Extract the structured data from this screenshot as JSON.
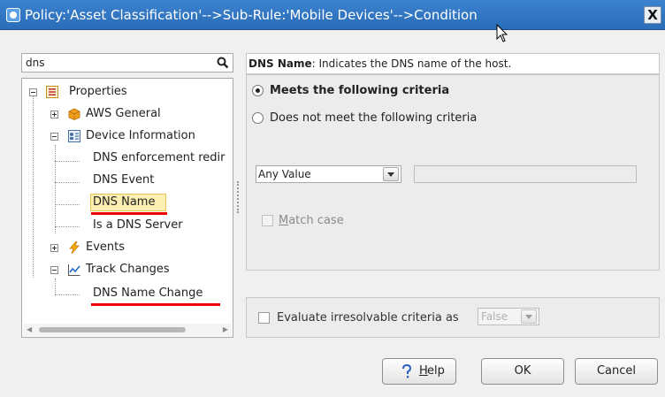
{
  "window": {
    "title": "Policy:'Asset Classification'-->Sub-Rule:'Mobile Devices'-->Condition",
    "close_label": "X"
  },
  "search": {
    "value": "dns"
  },
  "tree": {
    "root": "Properties",
    "aws_general": "AWS General",
    "device_information": "Device Information",
    "dns_enforcement": "DNS enforcement redir",
    "dns_event": "DNS Event",
    "dns_name": "DNS Name",
    "is_dns_server": "Is a DNS Server",
    "events": "Events",
    "track_changes": "Track Changes",
    "dns_name_change": "DNS Name Change",
    "selected": "DNS Name"
  },
  "description": {
    "field": "DNS Name",
    "text": ": Indicates the DNS name of the host."
  },
  "criteria": {
    "meets": "Meets the following criteria",
    "not_meets": "Does not meet the following criteria",
    "selected": "meets",
    "operator": "Any Value",
    "value": "",
    "match_case_prefix": "",
    "match_case_mnemonic": "M",
    "match_case_rest": "atch case",
    "match_case_checked": false
  },
  "evaluate": {
    "label": "Evaluate irresolvable criteria as",
    "value": "False",
    "checked": false
  },
  "buttons": {
    "help_mnemonic": "H",
    "help_rest": "elp",
    "ok": "OK",
    "cancel": "Cancel"
  },
  "colors": {
    "titlebar": "#2f77c4",
    "selection": "#fdefb2",
    "highlight_underline": "#e00000"
  }
}
